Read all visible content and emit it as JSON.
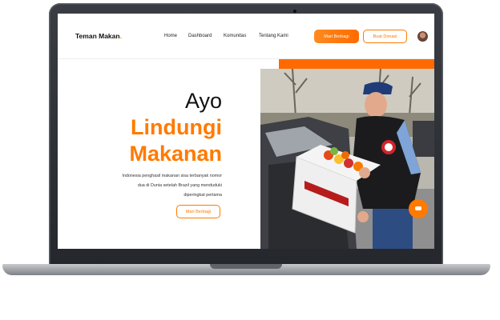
{
  "nav": {
    "brand": "Teman Makan",
    "brand_dot": ".",
    "links": [
      "Home",
      "Dashboard",
      "Komunitas",
      "Tentang Kami"
    ],
    "primary_button": "Mari Berbagi",
    "secondary_button": "Buat Donasi"
  },
  "hero": {
    "line1": "Ayo",
    "line2": "Lindungi",
    "line3": "Makanan",
    "description_lines": [
      "Indonesia penghasil makanan sisa terbanyak nomor",
      "dua di Dunia setelah Brazil yang menduduki",
      "diperingkat pertama"
    ],
    "cta_button": "Mari Berbagi"
  },
  "theme": {
    "accent": "#ff7a00"
  },
  "icons": {
    "chat": "chat-icon",
    "avatar": "user-avatar"
  }
}
